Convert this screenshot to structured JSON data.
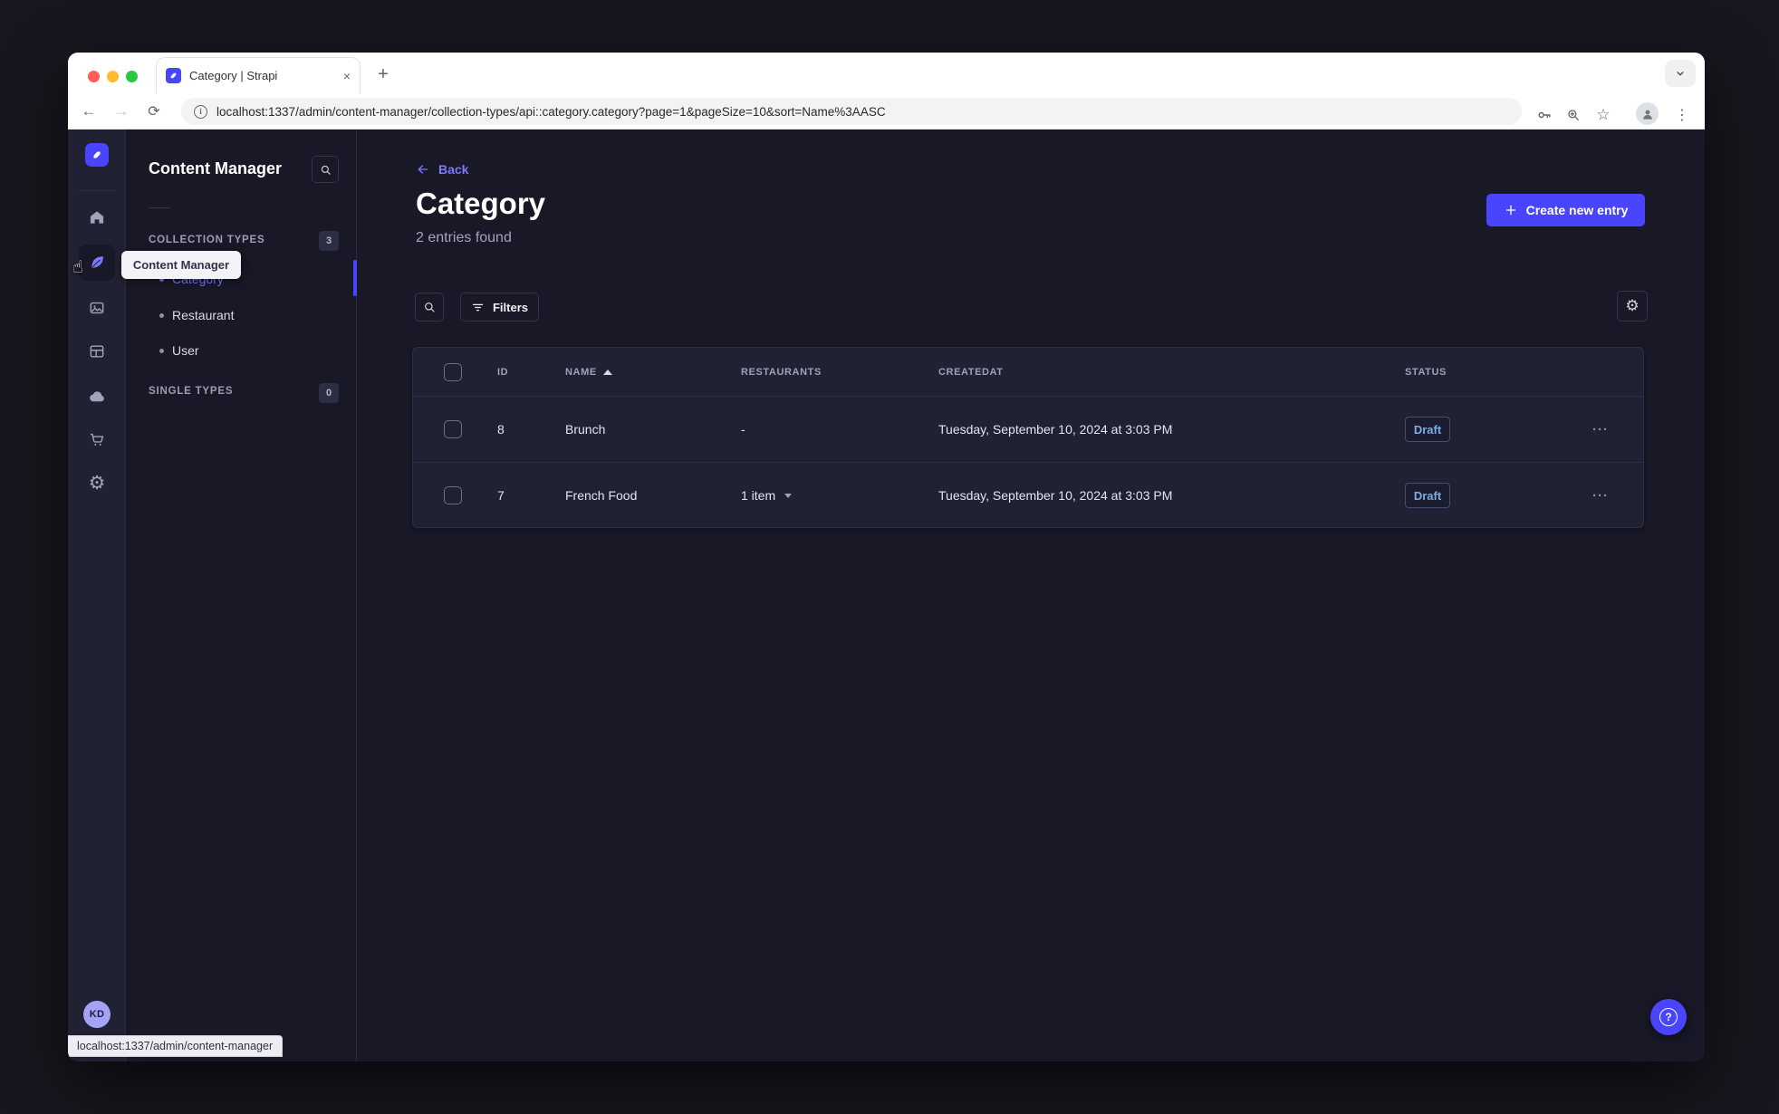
{
  "browser": {
    "tab_title": "Category | Strapi",
    "url": "localhost:1337/admin/content-manager/collection-types/api::category.category?page=1&pageSize=10&sort=Name%3AASC",
    "info_glyph": "i"
  },
  "icons": {
    "close_tab": "×",
    "new_tab": "+",
    "back": "←",
    "forward": "→",
    "reload": "⟳",
    "star": "☆",
    "overflow_menu": "⋮",
    "gear": "⚙",
    "hand_cursor": "☝",
    "ellipsis": "···",
    "question": "?"
  },
  "nav": {
    "tooltip": "Content Manager",
    "avatar_initials": "KD"
  },
  "subnav": {
    "title": "Content Manager",
    "collection_types": {
      "label": "COLLECTION TYPES",
      "count": "3"
    },
    "items": [
      {
        "label": "Category",
        "active": true
      },
      {
        "label": "Restaurant",
        "active": false
      },
      {
        "label": "User",
        "active": false
      }
    ],
    "single_types": {
      "label": "SINGLE TYPES",
      "count": "0"
    }
  },
  "main": {
    "back_label": "Back",
    "title": "Category",
    "subtitle": "2 entries found",
    "create_button_label": "Create new entry",
    "filters_label": "Filters",
    "table": {
      "columns": {
        "id": "ID",
        "name": "NAME",
        "restaurants": "RESTAURANTS",
        "createdat": "CREATEDAT",
        "status": "STATUS"
      },
      "rows": [
        {
          "id": "8",
          "name": "Brunch",
          "restaurants": "-",
          "createdat": "Tuesday, September 10, 2024 at 3:03 PM",
          "status": "Draft"
        },
        {
          "id": "7",
          "name": "French Food",
          "restaurants": "1 item",
          "createdat": "Tuesday, September 10, 2024 at 3:03 PM",
          "status": "Draft"
        }
      ]
    }
  },
  "status_bar": {
    "text": "localhost:1337/admin/content-manager"
  },
  "colors": {
    "primary": "#4945ff",
    "primary_light": "#7b79ff",
    "app_bg": "#181826",
    "surface": "#212134",
    "border": "#32324d",
    "draft_text": "#7aade4"
  }
}
